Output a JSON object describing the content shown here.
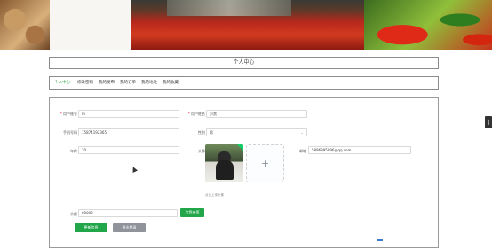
{
  "page_title": "个人中心",
  "tabs": [
    {
      "label": "个人中心",
      "active": true
    },
    {
      "label": "修改密码",
      "active": false
    },
    {
      "label": "我的发布",
      "active": false
    },
    {
      "label": "我的订单",
      "active": false
    },
    {
      "label": "我的地址",
      "active": false
    },
    {
      "label": "我的收藏",
      "active": false
    }
  ],
  "form": {
    "account": {
      "label": "用户账号",
      "value": "m"
    },
    "name": {
      "label": "用户姓名",
      "value": "小黑"
    },
    "phone": {
      "label": "手机号码",
      "value": "15874192365"
    },
    "gender": {
      "label": "性别",
      "value": "男"
    },
    "age": {
      "label": "年龄",
      "value": "20"
    },
    "avatar": {
      "label": "头像",
      "hint": "点击上传头像"
    },
    "email": {
      "label": "邮箱",
      "value": "5896995896@qq.com"
    },
    "balance": {
      "label": "余额",
      "value": "80000",
      "recharge_label": "点我充值"
    }
  },
  "actions": {
    "update_label": "更新信息",
    "logout_label": "退出登录"
  },
  "colors": {
    "accent": "#22a64a",
    "required": "#ee2233",
    "secondary_button": "#909399"
  },
  "icons": {
    "upload": "plus-icon",
    "cursor": "mouse-pointer-icon",
    "dropdown": "chevron-down-icon"
  }
}
